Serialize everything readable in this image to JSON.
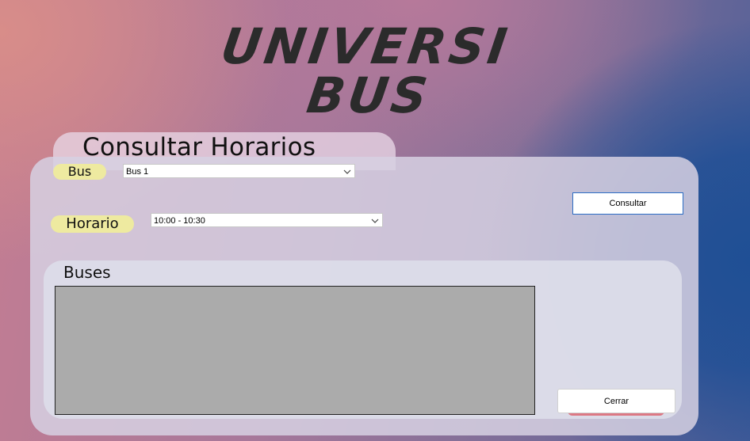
{
  "logo": {
    "line1": "UNIVERSI",
    "line2": "BUS"
  },
  "title": "Consultar Horarios",
  "bus": {
    "label": "Bus",
    "selected": "Bus 1"
  },
  "horario": {
    "label": "Horario",
    "selected": "10:00 - 10:30"
  },
  "buttons": {
    "consultar": "Consultar",
    "cerrar": "Cerrar"
  },
  "buses_section": {
    "label": "Buses"
  },
  "colors": {
    "pill": "#eeeaa0",
    "grid": "#ababab",
    "primary_border": "#2b6cc4",
    "cerrar_accent": "#dc7884"
  },
  "icons": {
    "dropdown": "chevron-down-icon"
  }
}
